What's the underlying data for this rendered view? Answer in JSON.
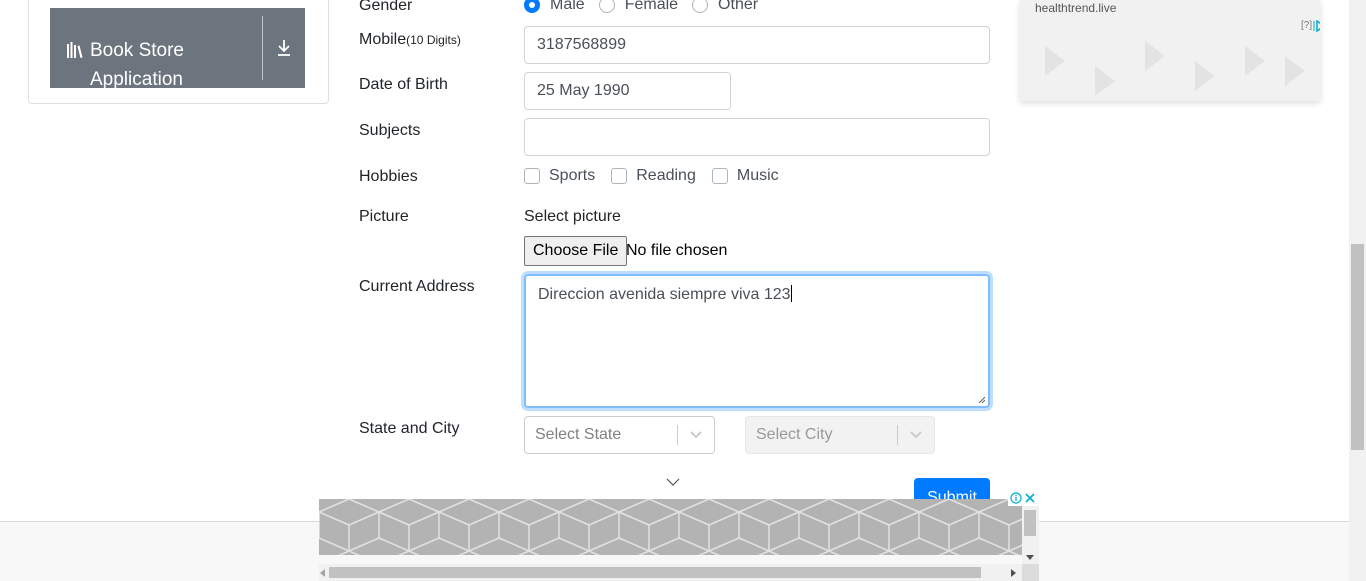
{
  "sidebar": {
    "book_store": {
      "label": "Book Store Application",
      "icon": "books-icon",
      "action_icon": "download-icon"
    }
  },
  "form": {
    "gender": {
      "label": "Gender",
      "options": [
        "Male",
        "Female",
        "Other"
      ],
      "selected": "Male"
    },
    "mobile": {
      "label": "Mobile",
      "hint": "(10 Digits)",
      "value": "3187568899"
    },
    "dob": {
      "label": "Date of Birth",
      "value": "25 May 1990"
    },
    "subjects": {
      "label": "Subjects",
      "value": ""
    },
    "hobbies": {
      "label": "Hobbies",
      "options": [
        "Sports",
        "Reading",
        "Music"
      ]
    },
    "picture": {
      "label": "Picture",
      "select_label": "Select picture",
      "button": "Choose File",
      "status": "No file chosen"
    },
    "address": {
      "label": "Current Address",
      "value": "Direccion avenida siempre viva 123"
    },
    "state_city": {
      "label": "State and City",
      "state_placeholder": "Select State",
      "city_placeholder": "Select City"
    },
    "submit": "Submit"
  },
  "ad_top": {
    "url": "healthtrend.live",
    "info": "[?]"
  },
  "colors": {
    "primary": "#007bff",
    "banner": "#6c757d",
    "focus_border": "#80bdff"
  }
}
